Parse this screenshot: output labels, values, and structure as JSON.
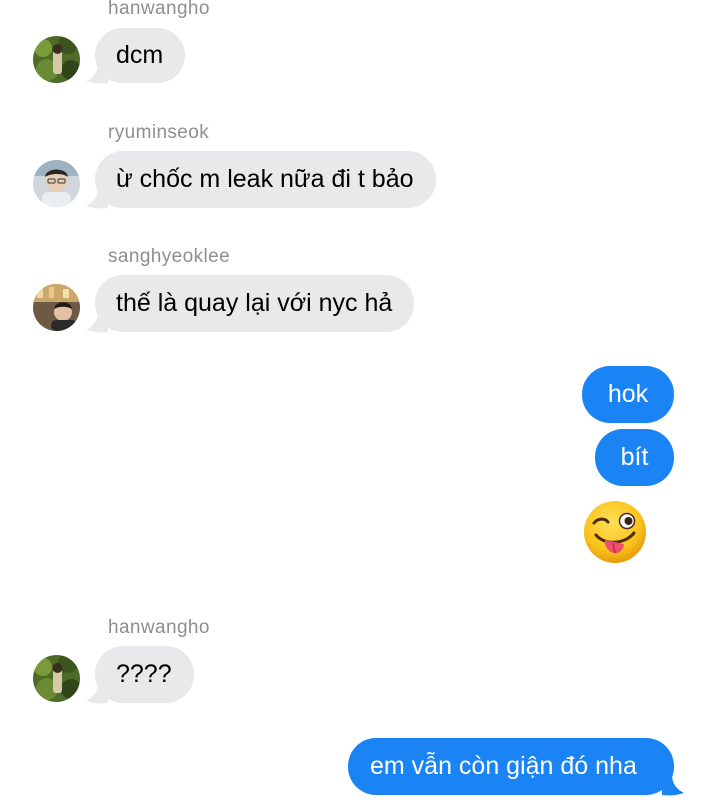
{
  "colors": {
    "incoming_bubble": "#e9e9eb",
    "outgoing_bubble": "#1a84f5",
    "sender_name": "#8e8e93"
  },
  "messages": [
    {
      "direction": "incoming",
      "sender": "hanwangho",
      "text": "dcm",
      "avatar": "avatar-hanwangho"
    },
    {
      "direction": "incoming",
      "sender": "ryuminseok",
      "text": "ừ chốc m leak nữa đi t bảo",
      "avatar": "avatar-ryuminseok"
    },
    {
      "direction": "incoming",
      "sender": "sanghyeoklee",
      "text": "thế là quay lại với nyc hả",
      "avatar": "avatar-sanghyeoklee"
    },
    {
      "direction": "outgoing",
      "text": "hok"
    },
    {
      "direction": "outgoing",
      "text": "bít"
    },
    {
      "direction": "outgoing",
      "emoji": "winking-face-with-tongue-icon"
    },
    {
      "direction": "incoming",
      "sender": "hanwangho",
      "text": "????",
      "avatar": "avatar-hanwangho"
    },
    {
      "direction": "outgoing",
      "text": "em vẫn còn giận đó nha"
    }
  ]
}
